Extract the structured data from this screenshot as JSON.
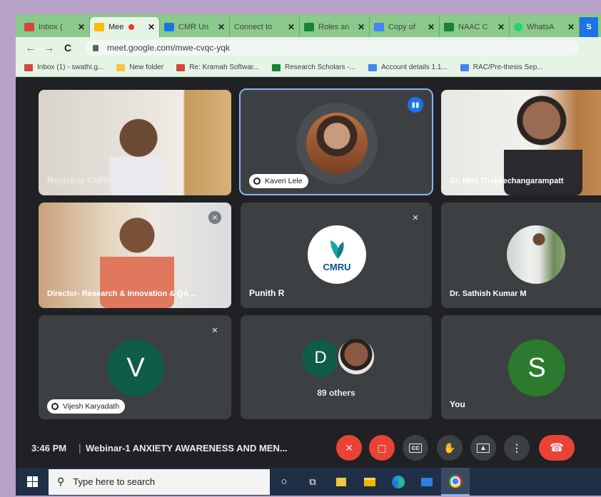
{
  "browser": {
    "tabs": [
      {
        "title": "Inbox (",
        "favicon": "gmail-icon",
        "color": "#d44638"
      },
      {
        "title": "Mee",
        "favicon": "meet-icon",
        "color": "#fbbc04",
        "active": true,
        "recording": true
      },
      {
        "title": "CMR Un",
        "favicon": "cmr-icon",
        "color": "#1a73e8"
      },
      {
        "title": "Connect to ",
        "favicon": "page-icon",
        "color": "#6aa86a"
      },
      {
        "title": "Roles an",
        "favicon": "sheets-icon",
        "color": "#188038"
      },
      {
        "title": "Copy of",
        "favicon": "docs-icon",
        "color": "#4285f4"
      },
      {
        "title": "NAAC C",
        "favicon": "sheets-icon",
        "color": "#188038"
      },
      {
        "title": "WhatsA",
        "favicon": "whatsapp-icon",
        "color": "#25d366"
      },
      {
        "title": "S",
        "favicon": "page-icon",
        "color": "#1a73e8"
      }
    ],
    "url": "meet.google.com/mwe-cvqc-yqk",
    "bookmarks": [
      {
        "label": "Inbox (1) - swathi.g...",
        "icon": "gmail-icon",
        "color": "#d44638"
      },
      {
        "label": "New folder",
        "icon": "folder-icon",
        "color": "#f4c542"
      },
      {
        "label": "Re: Kramah Softwar...",
        "icon": "gmail-icon",
        "color": "#d44638"
      },
      {
        "label": "Research Scholars -...",
        "icon": "sheets-icon",
        "color": "#188038"
      },
      {
        "label": "Account details 1.1...",
        "icon": "docs-icon",
        "color": "#4285f4"
      },
      {
        "label": "RAC/Pre-thesis Sep...",
        "icon": "docs-icon",
        "color": "#4285f4"
      }
    ]
  },
  "meet": {
    "participants": [
      {
        "name": "Registrar CMRU",
        "type": "video"
      },
      {
        "name": "Kaveri Lele",
        "type": "photo",
        "speaking": true
      },
      {
        "name": "Dr. Mini Thekkechangarampatt",
        "type": "video"
      },
      {
        "name": "Director- Research & Innovation & QA ...",
        "type": "video",
        "muted": true
      },
      {
        "name": "Punith R",
        "type": "logo",
        "logo_text": "CMRU",
        "muted": true
      },
      {
        "name": "Dr. Sathish Kumar M",
        "type": "photo"
      },
      {
        "name": "Vijesh Karyadath",
        "type": "letter",
        "letter": "V",
        "muted": true
      },
      {
        "name": "89 others",
        "type": "group",
        "letter": "D"
      },
      {
        "name": "You",
        "type": "letter",
        "letter": "S"
      }
    ],
    "time": "3:46 PM",
    "meeting_title": "Webinar-1 ANXIETY AWARENESS AND MEN..."
  },
  "taskbar": {
    "search_placeholder": "Type here to search"
  }
}
